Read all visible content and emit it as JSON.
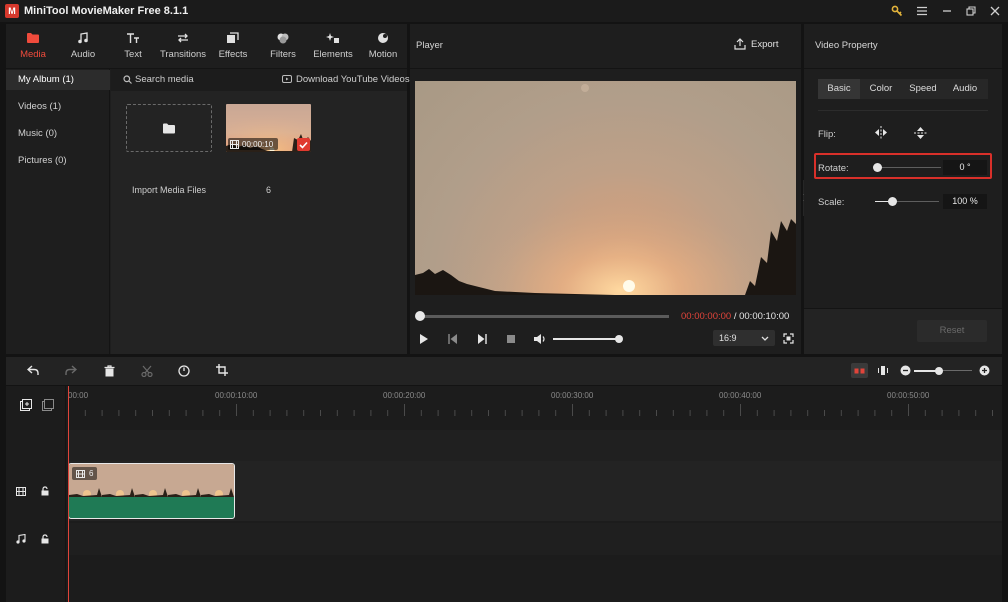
{
  "app": {
    "title": "MiniTool MovieMaker Free 8.1.1",
    "logo_letter": "M"
  },
  "toolbar": {
    "tabs": [
      {
        "label": "Media",
        "icon": "folder-icon",
        "active": true
      },
      {
        "label": "Audio",
        "icon": "music-note-icon"
      },
      {
        "label": "Text",
        "icon": "text-icon"
      },
      {
        "label": "Transitions",
        "icon": "transitions-icon"
      },
      {
        "label": "Effects",
        "icon": "effects-icon"
      },
      {
        "label": "Filters",
        "icon": "filters-icon"
      },
      {
        "label": "Elements",
        "icon": "elements-icon"
      },
      {
        "label": "Motion",
        "icon": "motion-icon"
      }
    ]
  },
  "sidebar": {
    "items": [
      {
        "label": "My Album  (1)",
        "active": true
      },
      {
        "label": "Videos  (1)"
      },
      {
        "label": "Music  (0)"
      },
      {
        "label": "Pictures  (0)"
      }
    ]
  },
  "media": {
    "search_placeholder": "Search media",
    "download_label": "Download YouTube Videos",
    "import_label": "Import Media Files",
    "items": [
      {
        "name": "6",
        "duration": "00:00:10",
        "selected": true
      }
    ]
  },
  "player": {
    "title": "Player",
    "export_label": "Export",
    "current_time": "00:00:00:00",
    "separator": "/",
    "total_time": "00:00:10:00",
    "aspect_ratio": "16:9",
    "progress": 0,
    "volume": 0.98
  },
  "properties": {
    "title": "Video Property",
    "tabs": [
      "Basic",
      "Color",
      "Speed",
      "Audio"
    ],
    "active_tab": "Basic",
    "flip_label": "Flip:",
    "rotate_label": "Rotate:",
    "rotate_value": "0 °",
    "scale_label": "Scale:",
    "scale_value": "100 %",
    "reset_label": "Reset"
  },
  "timeline": {
    "ruler_labels": [
      "00:00",
      "00:00:10:00",
      "00:00:20:00",
      "00:00:30:00",
      "00:00:40:00",
      "00:00:50:00"
    ],
    "clip_name": "6"
  },
  "colors": {
    "accent": "#ef4b3c",
    "highlight_border": "#d9302a",
    "clip_green": "#1f7a55"
  }
}
